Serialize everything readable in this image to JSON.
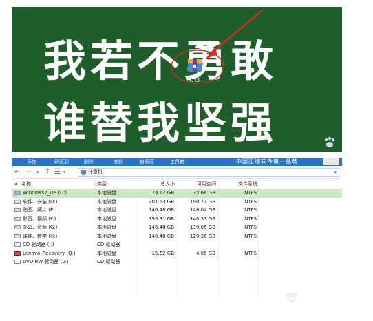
{
  "wallpaper": {
    "line1": "我若不勇敢",
    "line2": "谁替我坚强",
    "desktop_icon_label": "好压",
    "colors": {
      "background": "#1f5e2a",
      "arrow": "#d42a2a"
    }
  },
  "menubar": {
    "items": [
      "添加",
      "解压到",
      "删除",
      "查找",
      "自解压",
      "工具箱"
    ],
    "active_item": "工具箱",
    "slogan": "中国压缩软件第一品牌"
  },
  "address": {
    "location": "计算机"
  },
  "columns": {
    "name": "名称",
    "type": "类型",
    "total": "总大小",
    "free": "可用空间",
    "fs": "文件系统"
  },
  "drives": [
    {
      "name": "Windows7_OS (C:)",
      "type": "本地磁盘",
      "total": "78.12 GB",
      "free": "33.68 GB",
      "fs": "NTFS",
      "icon": "system-drive-icon",
      "selected": true
    },
    {
      "name": "软件、安装 (D:)",
      "type": "本地磁盘",
      "total": "201.53 GB",
      "free": "190.77 GB",
      "fs": "NTFS",
      "icon": "hard-drive-icon"
    },
    {
      "name": "贴图、照片 (E:)",
      "type": "本地磁盘",
      "total": "146.48 GB",
      "free": "146.04 GB",
      "fs": "NTFS",
      "icon": "hard-drive-icon"
    },
    {
      "name": "影音、视频 (F:)",
      "type": "本地磁盘",
      "total": "195.31 GB",
      "free": "140.33 GB",
      "fs": "NTFS",
      "icon": "hard-drive-icon"
    },
    {
      "name": "办公、资源 (G:)",
      "type": "本地磁盘",
      "total": "146.48 GB",
      "free": "139.05 GB",
      "fs": "NTFS",
      "icon": "hard-drive-icon"
    },
    {
      "name": "课件、教学 (H:)",
      "type": "本地磁盘",
      "total": "146.48 GB",
      "free": "129.36 GB",
      "fs": "NTFS",
      "icon": "hard-drive-icon"
    },
    {
      "name": "CD 驱动器 (J:)",
      "type": "CD 驱动器",
      "total": "",
      "free": "",
      "fs": "",
      "icon": "cd-drive-icon"
    },
    {
      "name": "Lenovo_Recovery (Q:)",
      "type": "本地磁盘",
      "total": "15.62 GB",
      "free": "4.06 GB",
      "fs": "NTFS",
      "icon": "recovery-drive-icon"
    },
    {
      "name": "DVD RW 驱动器 (V:)",
      "type": "CD 驱动器",
      "total": "",
      "free": "",
      "fs": "",
      "icon": "dvd-drive-icon"
    }
  ]
}
